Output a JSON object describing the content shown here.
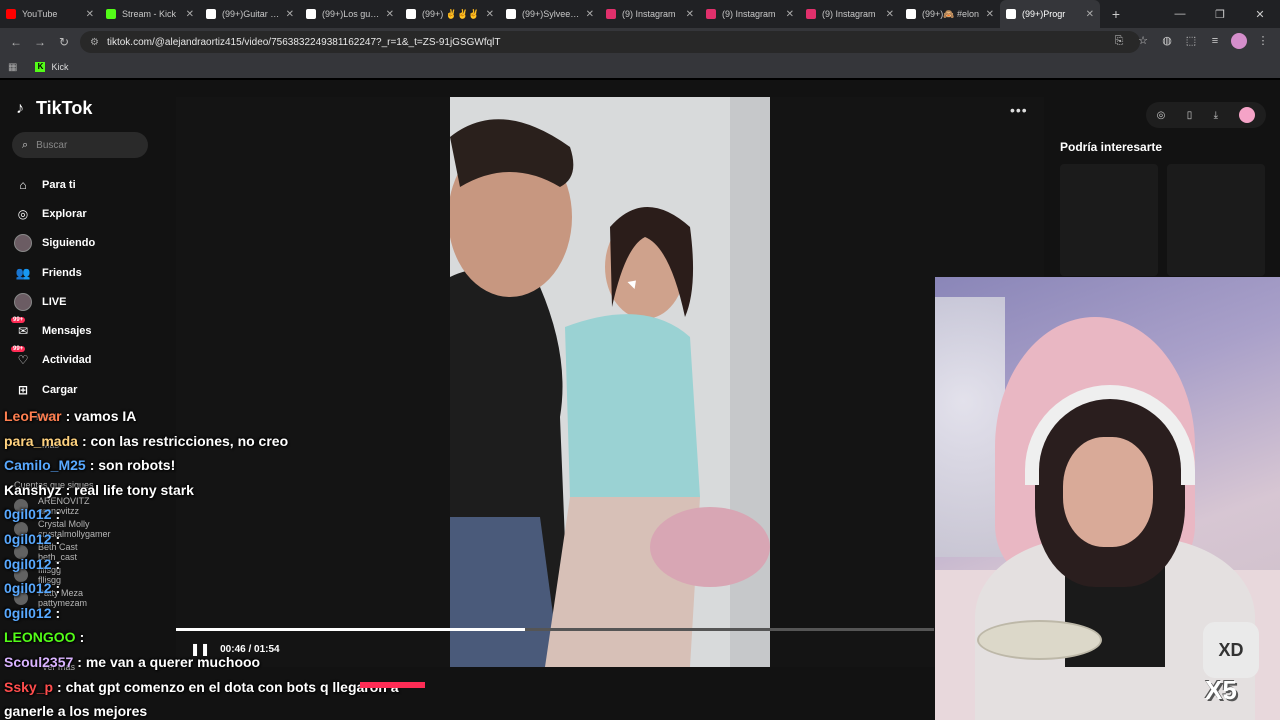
{
  "browser": {
    "tabs": [
      {
        "label": "YouTube",
        "color": "#ff0000"
      },
      {
        "label": "Stream - Kick",
        "color": "#53fc18"
      },
      {
        "label": "(99+)Guitar Co",
        "color": "#ffffff"
      },
      {
        "label": "(99+)Los gusto",
        "color": "#ffffff"
      },
      {
        "label": "(99+) ✌️✌️✌️",
        "color": "#ffffff"
      },
      {
        "label": "(99+)Sylvee ne",
        "color": "#ffffff"
      },
      {
        "label": "(9) Instagram",
        "color": "#e1306c"
      },
      {
        "label": "(9) Instagram",
        "color": "#e1306c"
      },
      {
        "label": "(9) Instagram",
        "color": "#e1306c"
      },
      {
        "label": "(99+)🙈 #elon",
        "color": "#ffffff"
      },
      {
        "label": "(99+)Progr",
        "color": "#ffffff",
        "active": true
      }
    ],
    "url": "tiktok.com/@alejandraortiz415/video/7563832249381162247?_r=1&_t=ZS-91jGSGWfqlT",
    "bookmark": "Kick"
  },
  "tiktok": {
    "logo": "TikTok",
    "search_placeholder": "Buscar",
    "nav": [
      {
        "label": "Para ti",
        "icon": "home-icon"
      },
      {
        "label": "Explorar",
        "icon": "compass-icon"
      },
      {
        "label": "Siguiendo",
        "icon": "avatar-icon"
      },
      {
        "label": "Friends",
        "icon": "friends-icon"
      },
      {
        "label": "LIVE",
        "icon": "live-icon"
      },
      {
        "label": "Mensajes",
        "icon": "messages-icon",
        "badge": "99+"
      },
      {
        "label": "Actividad",
        "icon": "activity-icon",
        "badge": "99+"
      },
      {
        "label": "Cargar",
        "icon": "upload-icon"
      }
    ],
    "ghost_menu": {
      "perfil": "Perfil",
      "mas": "Más",
      "following_title": "Cuentas que sigues",
      "accounts": [
        {
          "name": "ARENOVITZ",
          "handle": "arenovitzz"
        },
        {
          "name": "Crystal Molly",
          "handle": "crystalmollygamer"
        },
        {
          "name": "Beth Cast",
          "handle": "beth_cast"
        },
        {
          "name": "fllisgg",
          "handle": "fllisgg"
        },
        {
          "name": "Patty Meza",
          "handle": "pattymezam"
        }
      ],
      "see_more": "Ver más"
    },
    "video": {
      "time": "00:46 / 01:54",
      "progress": 0.46
    },
    "right_panel_title": "Podría interesarte"
  },
  "chat": [
    {
      "user": "LeoFwar",
      "color": "#ff7f50",
      "text": "vamos IA"
    },
    {
      "user": "para_mada",
      "color": "#ffd27f",
      "text": "con las restricciones, no creo"
    },
    {
      "user": "Camilo_M25",
      "color": "#59a9ff",
      "text": "son robots!"
    },
    {
      "user": "Kanshyz",
      "color": "#ffffff",
      "text": "real life tony stark"
    },
    {
      "user": "0gil012",
      "color": "#59a9ff",
      "text": ""
    },
    {
      "user": "0gil012",
      "color": "#59a9ff",
      "text": ""
    },
    {
      "user": "0gil012",
      "color": "#59a9ff",
      "text": ""
    },
    {
      "user": "0gil012",
      "color": "#59a9ff",
      "text": ""
    },
    {
      "user": "0gil012",
      "color": "#59a9ff",
      "text": ""
    },
    {
      "user": "LEONGOO",
      "color": "#53fc18",
      "text": ""
    },
    {
      "user": "Scoul2357",
      "color": "#d9b3ff",
      "text": "me van a querer muchooo"
    },
    {
      "user": "Ssky_p",
      "color": "#ff4d4d",
      "text": "chat gpt comenzo en el dota con bots q llegaron a ganerle a los mejores"
    }
  ],
  "webcam": {
    "badge_text": "XD",
    "multiplier": "X5"
  }
}
